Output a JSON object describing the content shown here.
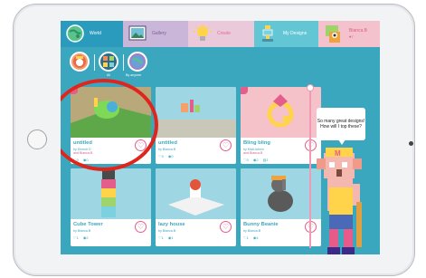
{
  "tabs": [
    {
      "label": "World",
      "color": "#2b9bbd"
    },
    {
      "label": "Gallery",
      "color": "#c9b6d9"
    },
    {
      "label": "Create",
      "color": "#e9c9da"
    },
    {
      "label": "My Designs",
      "color": "#63c6d5"
    },
    {
      "label": "Bianca.B",
      "sub": "♥7",
      "color": "#f4c2cc"
    }
  ],
  "filters": {
    "all_label": "All",
    "anyone_label": "By anyone"
  },
  "cards": [
    {
      "title": "untitled",
      "by_line": "by Dinesh D",
      "and_line": "and Bianca.B",
      "likes": "0",
      "views": "0",
      "comments": ""
    },
    {
      "title": "untitled",
      "by_line": "by Bianca.B",
      "and_line": "",
      "likes": "0",
      "views": "0",
      "comments": ""
    },
    {
      "title": "Bling bling",
      "by_line": "by Matt Admin",
      "and_line": "and Bianca.B",
      "likes": "0",
      "views": "2",
      "comments": "1"
    },
    {
      "title": "Cube Tower",
      "by_line": "by Bianca.B",
      "and_line": "",
      "likes": "1",
      "views": "2",
      "comments": ""
    },
    {
      "title": "lazy house",
      "by_line": "by Bianca.B",
      "and_line": "",
      "likes": "1",
      "views": "1",
      "comments": ""
    },
    {
      "title": "Bunny Beanie",
      "by_line": "by Bianca.B",
      "and_line": "",
      "likes": "1",
      "views": "4",
      "comments": ""
    }
  ],
  "bubble_text": "So many great designs! How will I top these?",
  "icons": {
    "like": "heart-icon",
    "view": "eye-icon",
    "comment": "comment-icon"
  },
  "colors": {
    "accent": "#3aa9c2",
    "pink": "#e35e8a",
    "background": "#3ba7bf",
    "annotation": "#e0251d"
  }
}
